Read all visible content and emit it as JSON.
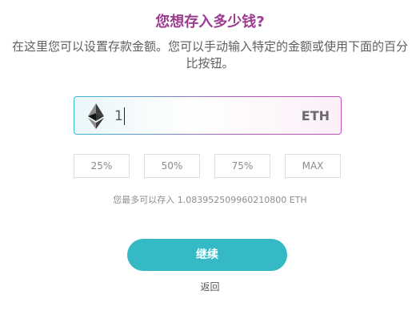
{
  "deposit": {
    "title": "您想存入多少钱?",
    "description": "在这里您可以设置存款金额。您可以手动输入特定的金额或使用下面的百分比按钮。",
    "amount_value": "1",
    "currency": "ETH",
    "currency_icon": "ethereum-icon",
    "percent_buttons": [
      "25%",
      "50%",
      "75%",
      "MAX"
    ],
    "max_note": "您最多可以存入 1.083952509960210800 ETH",
    "continue_label": "继续",
    "back_label": "返回"
  },
  "colors": {
    "title": "#9c3d91",
    "accent": "#35b9c5",
    "text_muted": "#8e8e8e"
  }
}
